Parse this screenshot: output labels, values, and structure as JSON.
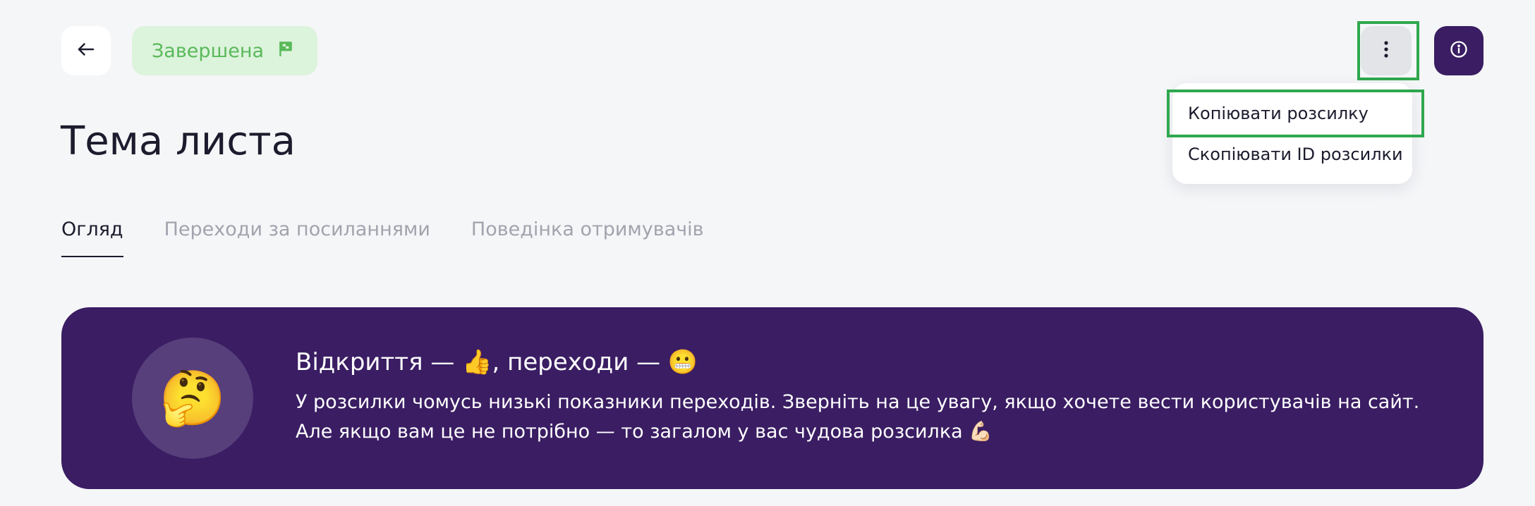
{
  "header": {
    "status": "Завершена",
    "more_menu": {
      "items": [
        "Копіювати розсилку",
        "Скопіювати ID розсилки"
      ]
    }
  },
  "title": "Тема листа",
  "tabs": [
    {
      "label": "Огляд",
      "active": true
    },
    {
      "label": "Переходи за посиланнями",
      "active": false
    },
    {
      "label": "Поведінка отримувачів",
      "active": false
    }
  ],
  "banner": {
    "emoji": "🤔",
    "heading": "Відкриття — 👍, переходи — 😬",
    "line1": "У розсилки чомусь низькі показники переходів. Зверніть на це увагу, якщо хочете вести користувачів на сайт.",
    "line2": "Але якщо вам це не потрібно — то загалом у вас чудова розсилка 💪🏻"
  },
  "icons": {
    "back": "arrow-left-icon",
    "status": "flag-icon",
    "more": "more-vertical-icon",
    "info": "info-circle-icon"
  },
  "colors": {
    "accent": "#3a1d63",
    "status_bg": "#dcf3dc",
    "status_text": "#5ab95a",
    "highlight": "#2fa84f"
  }
}
